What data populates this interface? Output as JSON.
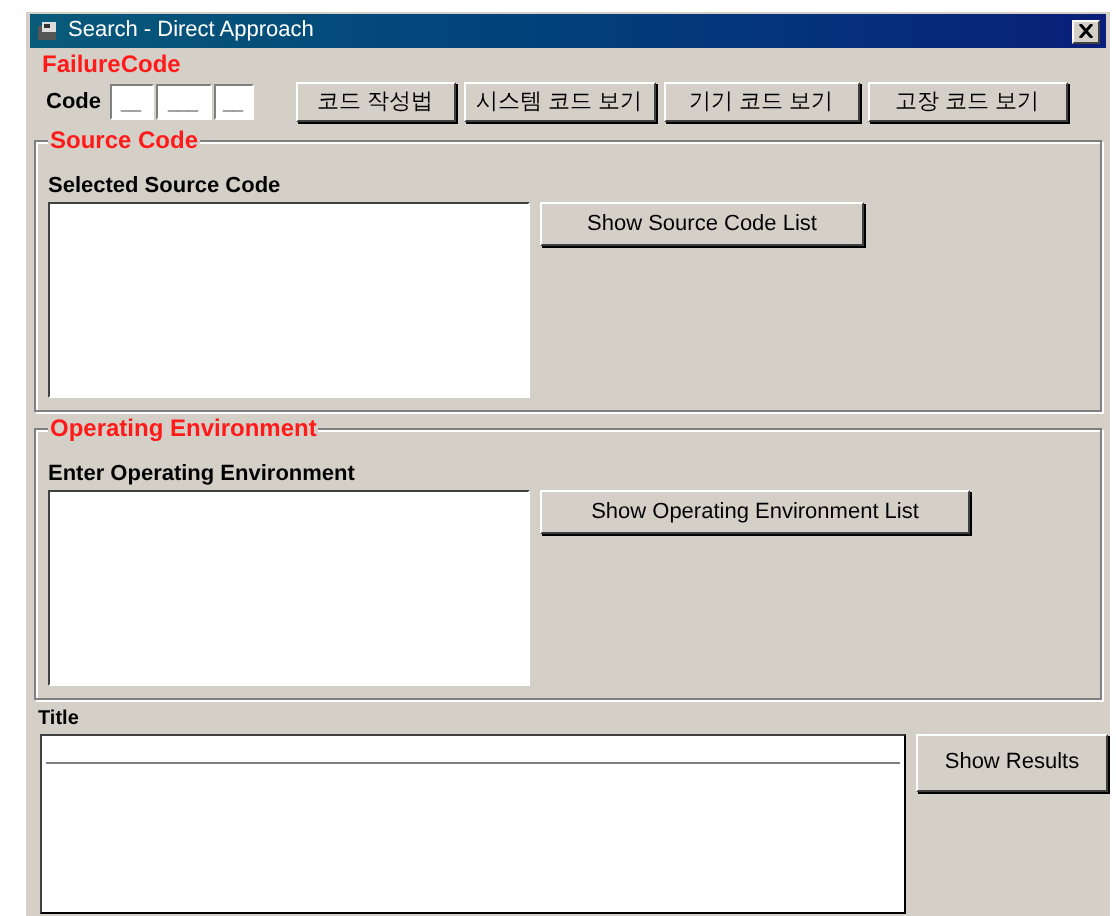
{
  "window": {
    "title": "Search - Direct Approach"
  },
  "failure_code": {
    "heading": "FailureCode",
    "label": "Code",
    "fields": [
      "__",
      "___",
      "__"
    ],
    "buttons": [
      "코드 작성법",
      "시스템 코드 보기",
      "기기 코드 보기",
      "고장 코드 보기"
    ]
  },
  "source_code": {
    "heading": "Source Code",
    "label": "Selected Source Code",
    "button": "Show Source Code List"
  },
  "operating_environment": {
    "heading": "Operating Environment",
    "label": "Enter Operating Environment",
    "button": "Show Operating Environment List"
  },
  "title": {
    "label": "Title",
    "button": "Show Results"
  }
}
